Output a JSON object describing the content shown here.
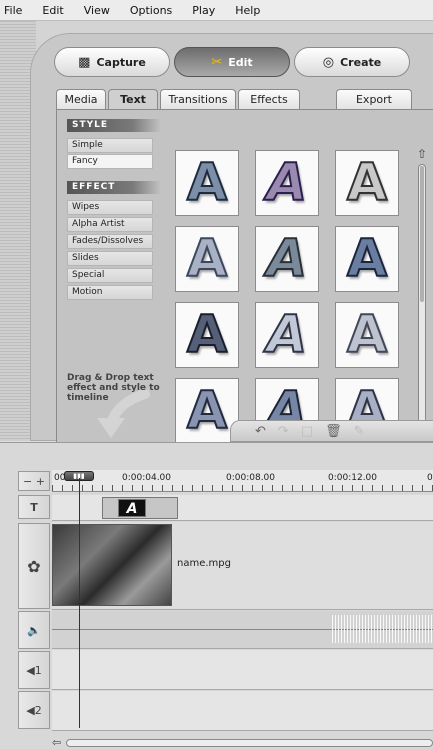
{
  "menu": [
    "File",
    "Edit",
    "View",
    "Options",
    "Play",
    "Help"
  ],
  "modes": {
    "capture": "Capture",
    "edit": "Edit",
    "create": "Create"
  },
  "tabs": [
    "Media",
    "Text",
    "Transitions",
    "Effects",
    "Export"
  ],
  "active_tab": "Text",
  "style_section": {
    "title": "STYLE",
    "items": [
      "Simple",
      "Fancy"
    ],
    "selected": "Fancy"
  },
  "effect_section": {
    "title": "EFFECT",
    "items": [
      "Wipes",
      "Alpha Artist",
      "Fades/Dissolves",
      "Slides",
      "Special",
      "Motion"
    ]
  },
  "drag_hint": "Drag & Drop text effect and style to timeline",
  "thumbnails": {
    "glyph": "A",
    "styles": [
      {
        "fill": "#7d8fa8",
        "outline": "#1e2c40"
      },
      {
        "fill": "#9a8ab0",
        "outline": "#2a2050"
      },
      {
        "fill": "#c9c9c9",
        "outline": "#333333"
      },
      {
        "fill": "#a9b2c4",
        "outline": "#3b4860"
      },
      {
        "fill": "#7a8a9a",
        "outline": "#2a3038"
      },
      {
        "fill": "#6a7fa0",
        "outline": "#1a2540"
      },
      {
        "fill": "#555f78",
        "outline": "#1a1f2e"
      },
      {
        "fill": "#c2c8d6",
        "outline": "#2e3548"
      },
      {
        "fill": "#bfc3cf",
        "outline": "#40485a"
      },
      {
        "fill": "#8894b0",
        "outline": "#202a40"
      },
      {
        "fill": "#7686a4",
        "outline": "#1b2438"
      },
      {
        "fill": "#a9b0c6",
        "outline": "#2c3446"
      }
    ]
  },
  "timeline": {
    "start_label": "00.00",
    "ticks": [
      "0:00:04.00",
      "0:00:08.00",
      "0:00:12.00",
      "0"
    ],
    "title_clip_glyph": "A",
    "video_clip_name": "name.mpg",
    "audio_track_label": "1",
    "audio_track_label_2": "2"
  },
  "colors": {
    "accent_edit": "#f0c000",
    "panel_bg": "#c3c3c3"
  }
}
